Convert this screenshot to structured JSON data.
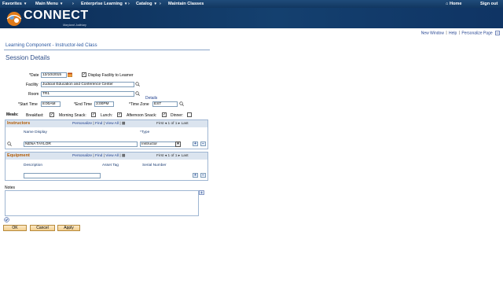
{
  "topnav": {
    "favorites": "Favorites",
    "main_menu": "Main Menu",
    "breadcrumb_1": "Enterprise Learning",
    "breadcrumb_2": "Catalog",
    "breadcrumb_3": "Maintain Classes",
    "home": "Home",
    "sign_out": "Sign out"
  },
  "banner": {
    "logo_text": "CONNECT",
    "logo_sub": "Maryland Judiciary"
  },
  "toplinks": {
    "new_window": "New Window",
    "help": "Help",
    "personalize_page": "Personalize Page"
  },
  "page": {
    "component_title": "Learning Component - Instructor-led Class",
    "section_title": "Session Details"
  },
  "form": {
    "date_label": "*Date",
    "date_value": "12/10/2015",
    "display_facility_label": "Display Facility to Learner",
    "facility_label": "Facility",
    "facility_value": "Judicial Education and Conference Center",
    "room_label": "Room",
    "room_value": "TR1",
    "details_link": "Details",
    "start_time_label": "*Start Time",
    "start_time_value": "8:00AM",
    "end_time_label": "*End Time",
    "end_time_value": "3:00PM",
    "time_zone_label": "*Time Zone",
    "time_zone_value": "EST"
  },
  "meals": {
    "label": "Meals:",
    "breakfast": "Breakfast:",
    "morning_snack": "Morning Snack:",
    "lunch": "Lunch:",
    "afternoon_snack": "Afternoon Snack:",
    "dinner": "Dinner:"
  },
  "instructors": {
    "title": "Instructors",
    "personalize": "Personalize",
    "find": "Find",
    "view_all": "View All",
    "first": "First",
    "counter": "1 of 1",
    "last": "Last",
    "col_name": "Name Display",
    "col_type": "*Type",
    "row_name": "NENA TAYLOR",
    "row_type": "Instructor"
  },
  "equipment": {
    "title": "Equipment",
    "personalize": "Personalize",
    "find": "Find",
    "view_all": "View All",
    "first": "First",
    "counter": "1 of 1",
    "last": "Last",
    "col_description": "Description",
    "col_asset_tag": "Asset Tag",
    "col_serial": "Serial Number"
  },
  "notes": {
    "label": "Notes"
  },
  "buttons": {
    "ok": "OK",
    "cancel": "Cancel",
    "apply": "Apply"
  },
  "colors": {
    "nav_bg": "#123760",
    "banner_bg": "#0c2d57",
    "link": "#1f3f8f",
    "grid_title": "#b35a00",
    "button_bg": "#f3cf8e"
  }
}
